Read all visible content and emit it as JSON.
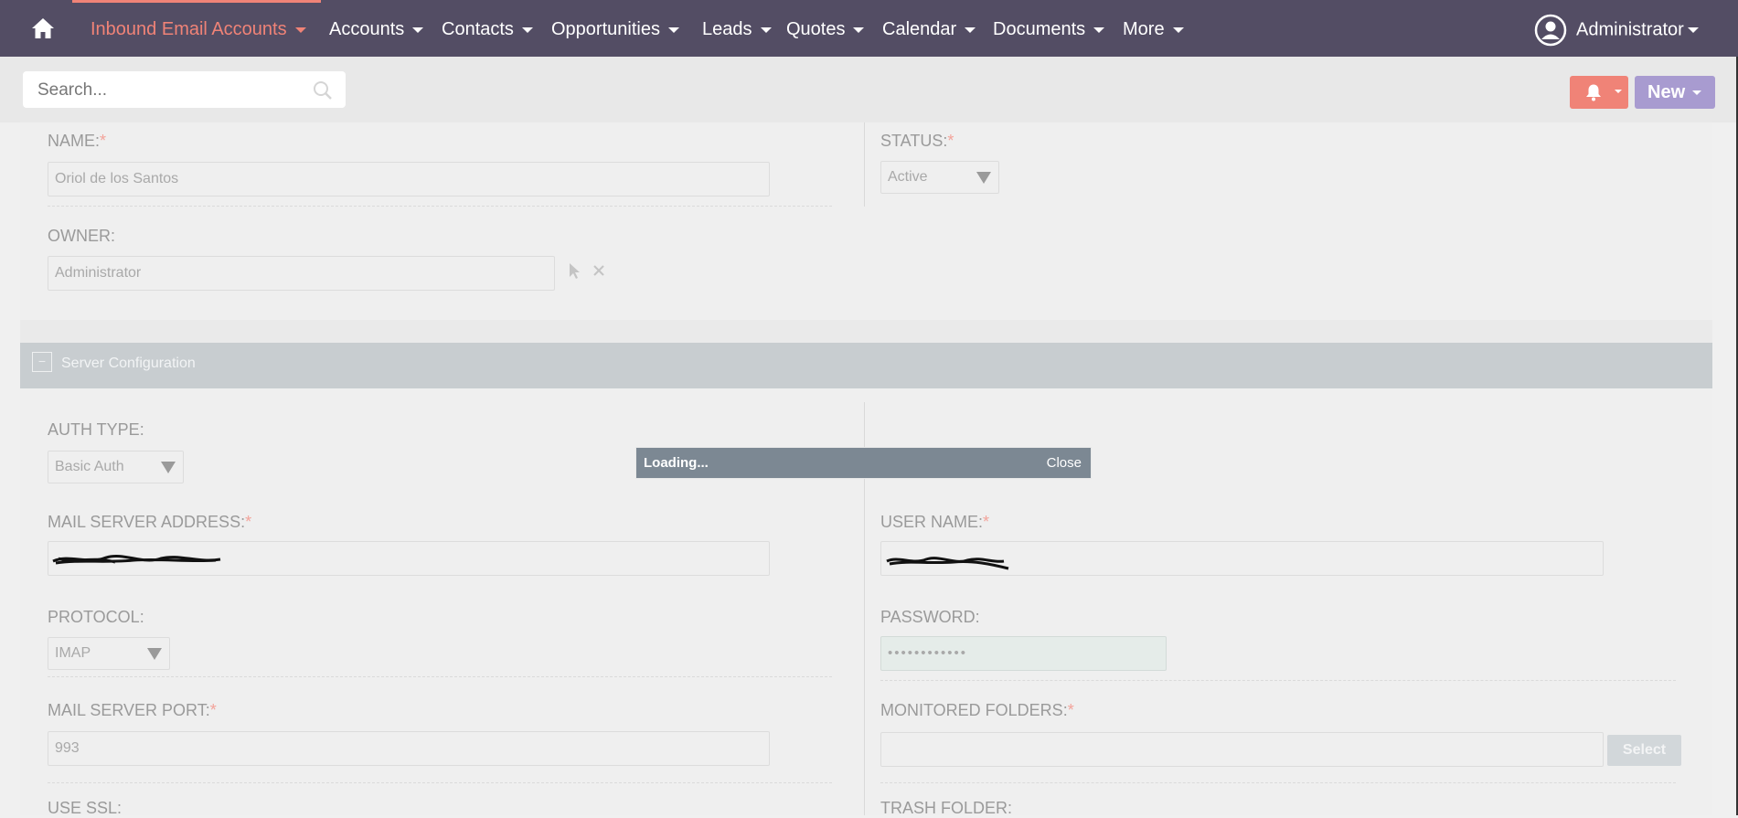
{
  "nav": {
    "items": [
      {
        "label": "Inbound Email Accounts",
        "active": true
      },
      {
        "label": "Accounts"
      },
      {
        "label": "Contacts"
      },
      {
        "label": "Opportunities"
      },
      {
        "label": "Leads"
      },
      {
        "label": "Quotes"
      },
      {
        "label": "Calendar"
      },
      {
        "label": "Documents"
      },
      {
        "label": "More"
      }
    ],
    "user": "Administrator",
    "colors": {
      "bar": "#534d64",
      "active": "#f08377"
    }
  },
  "search": {
    "placeholder": "Search..."
  },
  "actions": {
    "new_label": "New"
  },
  "form": {
    "name_label": "NAME:",
    "name_value": "Oriol de los Santos",
    "status_label": "STATUS:",
    "status_value": "Active",
    "owner_label": "OWNER:",
    "owner_value": "Administrator",
    "panel_title": "Server Configuration",
    "panel_collapse": "−",
    "auth_type_label": "AUTH TYPE:",
    "auth_type_value": "Basic Auth",
    "mail_server_label": "MAIL SERVER ADDRESS:",
    "username_label": "USER NAME:",
    "protocol_label": "PROTOCOL:",
    "protocol_value": "IMAP",
    "password_label": "PASSWORD:",
    "password_value": "••••••••••••",
    "port_label": "MAIL SERVER PORT:",
    "port_value": "993",
    "monitored_label": "MONITORED FOLDERS:",
    "select_label": "Select",
    "use_ssl_label": "USE SSL:",
    "trash_label": "TRASH FOLDER:",
    "required_mark": "*"
  },
  "loading": {
    "text": "Loading...",
    "close": "Close"
  }
}
